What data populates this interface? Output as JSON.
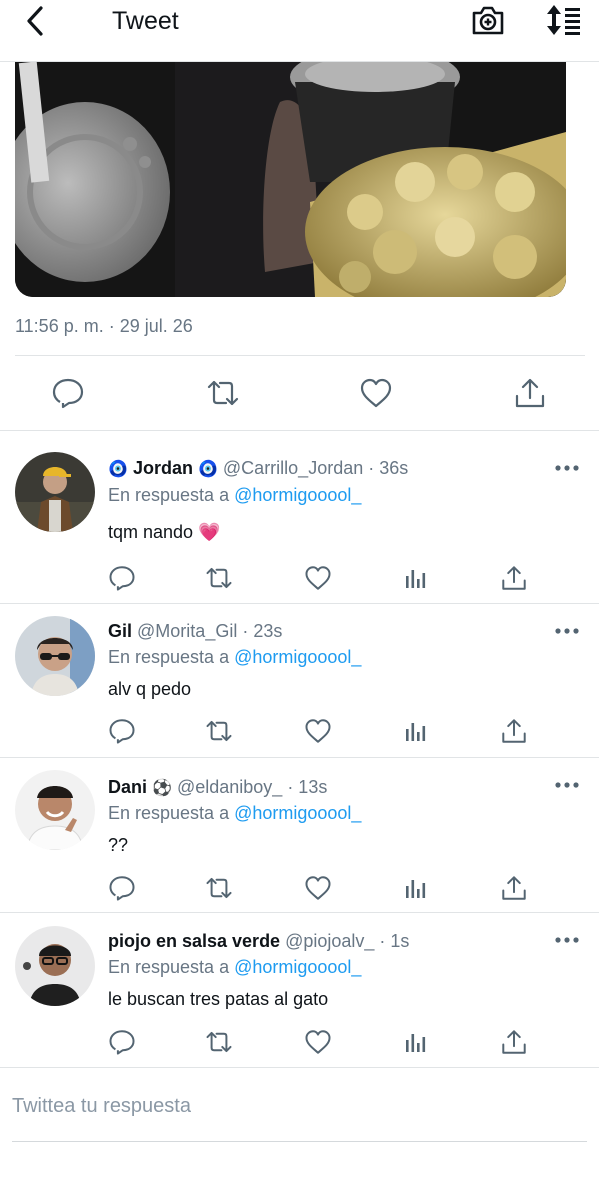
{
  "header": {
    "title": "Tweet",
    "icons": {
      "back": "chevron-left-icon",
      "camera": "camera-plus-icon",
      "sort": "sort-arrows-icon"
    }
  },
  "tweet": {
    "timestamp": "11:56 p. m. · 29 jul. 26",
    "actions": [
      "reply-icon",
      "retweet-icon",
      "like-icon",
      "share-icon"
    ]
  },
  "replies": [
    {
      "name": "Jordan",
      "name_prefix": "🧿",
      "name_suffix": "🧿",
      "handle_time": "@Carrillo_Jordan · 36s",
      "reply_label": "En respuesta a",
      "mention": "@hormigooool_",
      "text": "tqm nando 💗"
    },
    {
      "name": "Gil",
      "name_prefix": "",
      "name_suffix": "",
      "handle_time": "@Morita_Gil · 23s",
      "reply_label": "En respuesta a",
      "mention": "@hormigooool_",
      "text": "alv q pedo"
    },
    {
      "name": "Dani",
      "name_prefix": "",
      "name_suffix": "⚽",
      "handle_time": "@eldaniboy_ · 13s",
      "reply_label": "En respuesta a",
      "mention": "@hormigooool_",
      "text": "??"
    },
    {
      "name": "piojo en salsa verde",
      "name_prefix": "",
      "name_suffix": "",
      "handle_time": "@piojoalv_ · 1s",
      "reply_label": "En respuesta a",
      "mention": "@hormigooool_",
      "text": "le buscan tres patas al gato"
    }
  ],
  "composer": {
    "placeholder": "Twittea tu respuesta"
  },
  "colors": {
    "link": "#1d9bf0",
    "muted": "#687684",
    "text": "#0f1419",
    "divider": "#e1e4e6"
  }
}
